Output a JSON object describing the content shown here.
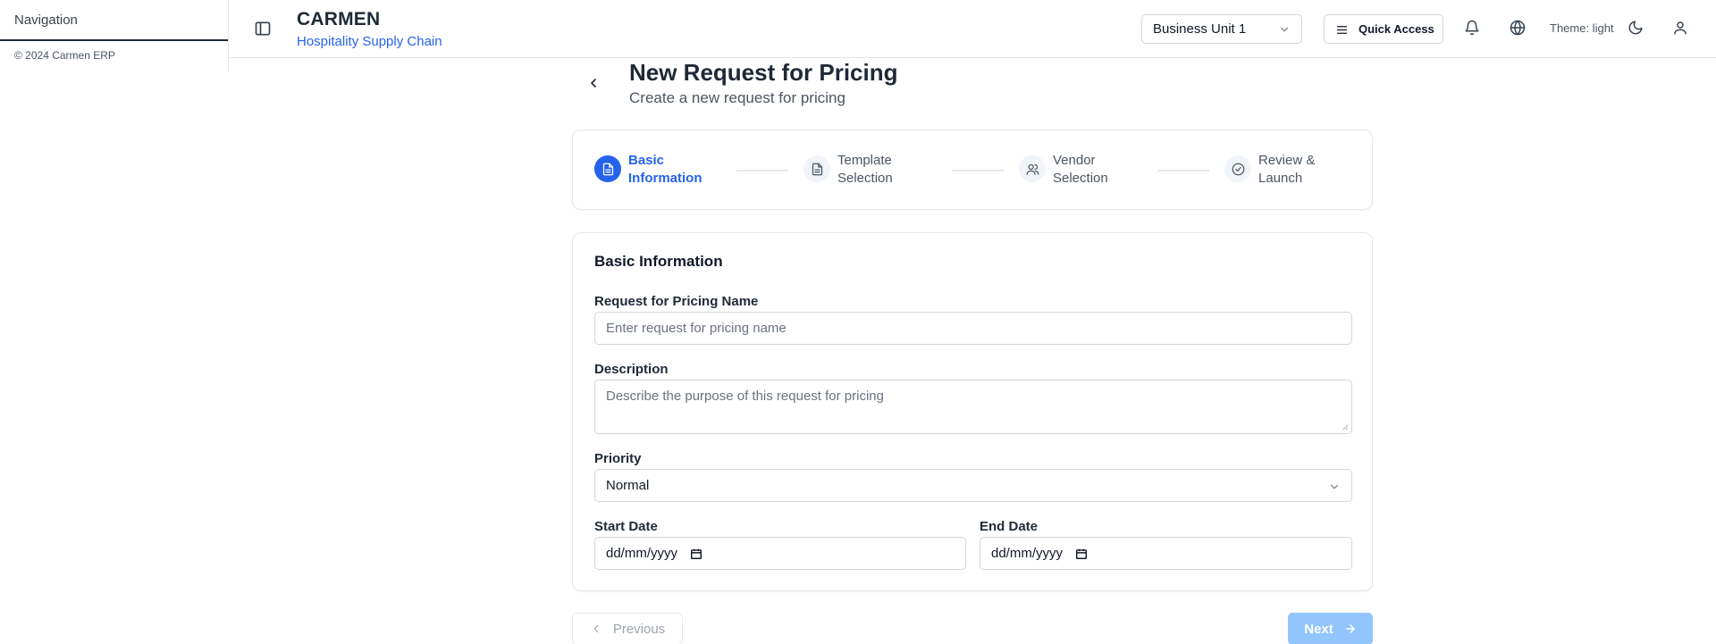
{
  "sidebar": {
    "title": "Navigation",
    "copyright": "© 2024 Carmen ERP"
  },
  "header": {
    "brand_name": "CARMEN",
    "brand_sub": "Hospitality Supply Chain",
    "business_unit": "Business Unit 1",
    "quick_access": "Quick Access",
    "theme_label": "Theme: light",
    "icons": [
      "sidebar-toggle-icon",
      "bell-icon",
      "globe-icon",
      "moon-icon",
      "user-icon"
    ]
  },
  "page": {
    "title": "New Request for Pricing",
    "subtitle": "Create a new request for pricing"
  },
  "steps": [
    {
      "label": "Basic Information",
      "icon": "document-icon",
      "active": true
    },
    {
      "label": "Template Selection",
      "icon": "document-icon",
      "active": false
    },
    {
      "label": "Vendor Selection",
      "icon": "users-icon",
      "active": false
    },
    {
      "label": "Review & Launch",
      "icon": "check-circle-icon",
      "active": false
    }
  ],
  "form": {
    "section_title": "Basic Information",
    "name_label": "Request for Pricing Name",
    "name_placeholder": "Enter request for pricing name",
    "description_label": "Description",
    "description_placeholder": "Describe the purpose of this request for pricing",
    "priority_label": "Priority",
    "priority_value": "Normal",
    "start_date_label": "Start Date",
    "start_date_value": "dd/mm/yyyy",
    "end_date_label": "End Date",
    "end_date_value": "dd/mm/yyyy"
  },
  "actions": {
    "previous": "Previous",
    "next": "Next"
  },
  "colors": {
    "accent": "#2563eb",
    "next_disabled": "#93c5fd"
  }
}
